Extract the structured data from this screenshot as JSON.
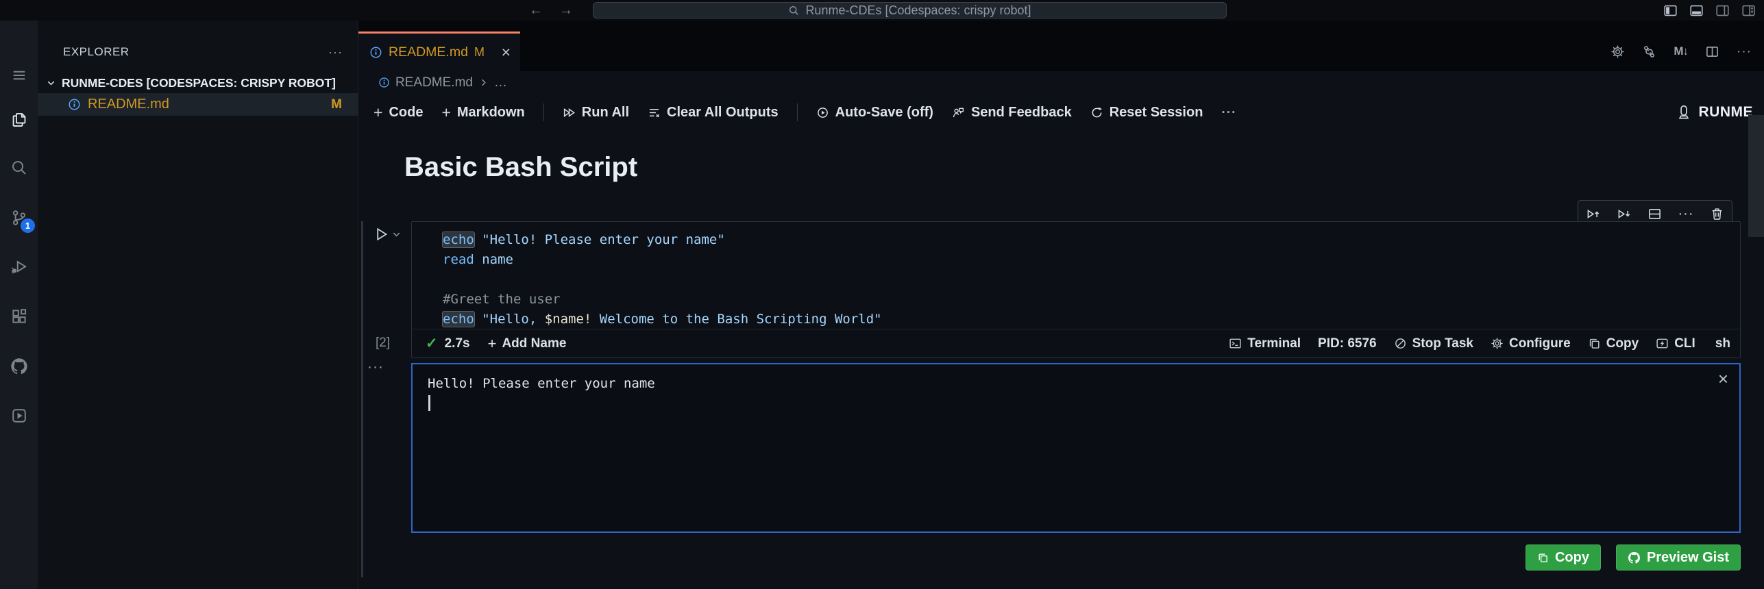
{
  "colors": {
    "accent": "#f78166",
    "modified": "#d29922",
    "badge": "#1f6feb",
    "info": "#58a6ff",
    "success": "#3fb950",
    "button": "#2ea043",
    "focus": "#2e66c7",
    "cmd": "#79c0ff",
    "str": "#a5d6ff",
    "comment": "#8b949e",
    "varname": "#e8e3cf"
  },
  "icons": {
    "back": "←",
    "forward": "→",
    "more": "···",
    "close": "×",
    "check": "✓",
    "plus": "+",
    "md_preview": "M↓",
    "search": "svg",
    "files": "svg",
    "source-control": "svg",
    "run-and-debug": "svg",
    "extensions": "svg",
    "github": "svg",
    "runme": "svg",
    "gear": "svg",
    "trash": "svg",
    "terminal": "svg",
    "stop-circle": "svg",
    "copy": "svg",
    "split": "svg"
  },
  "titlebar": {
    "search": "Runme-CDEs [Codespaces: crispy robot]"
  },
  "activity": {
    "scm_badge": "1"
  },
  "sidebar": {
    "title": "EXPLORER",
    "section": "RUNME-CDES [CODESPACES: CRISPY ROBOT]",
    "file": {
      "name": "README.md",
      "badge": "M"
    }
  },
  "tab": {
    "name": "README.md",
    "dirty": "M"
  },
  "breadcrumb": {
    "file": "README.md",
    "more": "…"
  },
  "toolbar": {
    "code": "Code",
    "markdown": "Markdown",
    "run_all": "Run All",
    "clear_all": "Clear All Outputs",
    "auto_save": "Auto-Save (off)",
    "send_feedback": "Send Feedback",
    "reset_session": "Reset Session",
    "brand": "RUNME"
  },
  "doc": {
    "heading": "Basic Bash Script"
  },
  "cell": {
    "exec_count": "[2]",
    "duration": "2.7s",
    "add_name": "Add Name",
    "lang": "sh",
    "status": {
      "terminal": "Terminal",
      "pid": "PID: 6576",
      "stop": "Stop Task",
      "configure": "Configure",
      "copy": "Copy",
      "cli": "CLI"
    },
    "code": {
      "l1": {
        "cmd": "echo",
        "str": " \"Hello! Please enter your name\""
      },
      "l2": {
        "cmd": "read",
        "arg": " name"
      },
      "l4": {
        "comment": "#Greet the user"
      },
      "l5": {
        "cmd": "echo",
        "str1": " \"Hello, ",
        "var": "$name!",
        "str2": " Welcome to the Bash Scripting World\""
      }
    }
  },
  "output": {
    "line": "Hello! Please enter your name",
    "copy": "Copy",
    "preview": "Preview Gist"
  }
}
